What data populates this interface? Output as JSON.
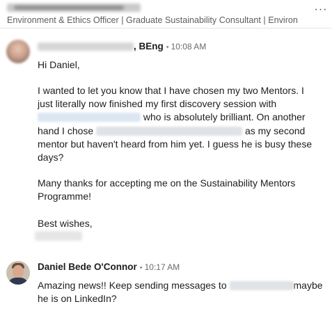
{
  "header": {
    "headline": "Environment & Ethics Officer | Graduate Sustainability Consultant | Environ",
    "more_label": "···"
  },
  "messages": [
    {
      "sender_suffix": ", BEng",
      "separator": "•",
      "time": "10:08 AM",
      "greeting": "Hi Daniel,",
      "lines": [
        "I wanted to let you know that I have chosen my two Mentors. I",
        "just literally now finished my first discovery session with",
        "who is absolutely brilliant. On another",
        "hand I chose",
        "as my second",
        "mentor but haven't heard from him yet. I guess he is busy these",
        "days?"
      ],
      "thanks_lines": [
        "Many thanks for accepting me on the Sustainability Mentors",
        "Programme!"
      ],
      "signoff": "Best wishes,"
    },
    {
      "sender": "Daniel Bede O'Connor",
      "separator": "•",
      "time": "10:17 AM",
      "reply_pre": "Amazing news!! Keep sending messages to",
      "reply_post": "maybe",
      "reply_line2": "he is on LinkedIn?"
    }
  ]
}
